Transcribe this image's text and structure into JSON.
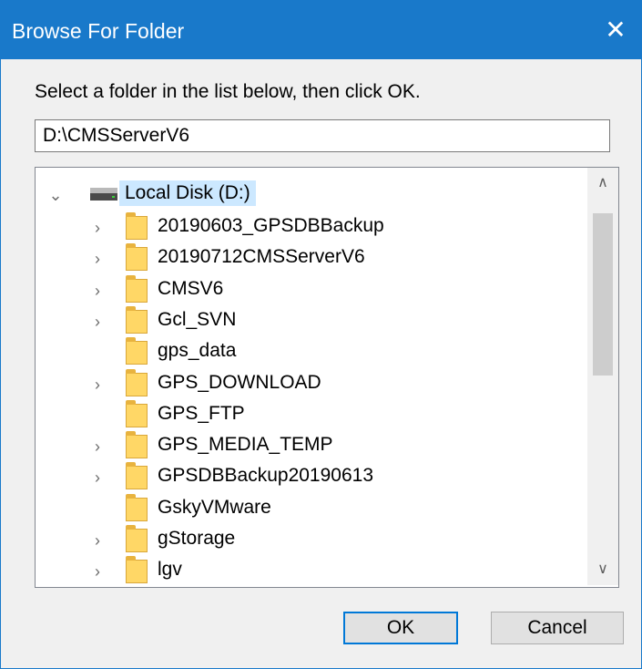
{
  "dialog": {
    "title": "Browse For Folder",
    "close_glyph": "✕",
    "instruction": "Select a folder in the list below, then click OK.",
    "path_value": "D:\\CMSServerV6"
  },
  "tree": {
    "root": {
      "label": "Local Disk (D:)",
      "icon": "drive-icon",
      "expanded": true,
      "selected": true
    },
    "items": [
      {
        "label": "20190603_GPSDBBackup",
        "has_children": true
      },
      {
        "label": "20190712CMSServerV6",
        "has_children": true
      },
      {
        "label": "CMSV6",
        "has_children": true
      },
      {
        "label": "Gcl_SVN",
        "has_children": true
      },
      {
        "label": "gps_data",
        "has_children": false
      },
      {
        "label": "GPS_DOWNLOAD",
        "has_children": true
      },
      {
        "label": "GPS_FTP",
        "has_children": false
      },
      {
        "label": "GPS_MEDIA_TEMP",
        "has_children": true
      },
      {
        "label": "GPSDBBackup20190613",
        "has_children": true
      },
      {
        "label": "GskyVMware",
        "has_children": false
      },
      {
        "label": "gStorage",
        "has_children": true
      },
      {
        "label": "lgv",
        "has_children": true
      }
    ],
    "expand_glyph": "›",
    "collapse_glyph": "⌄"
  },
  "scrollbar": {
    "up_glyph": "∧",
    "down_glyph": "∨"
  },
  "buttons": {
    "ok": "OK",
    "cancel": "Cancel"
  },
  "colors": {
    "titlebar": "#1979ca",
    "selection": "#cce8ff",
    "folder": "#ffd766"
  }
}
